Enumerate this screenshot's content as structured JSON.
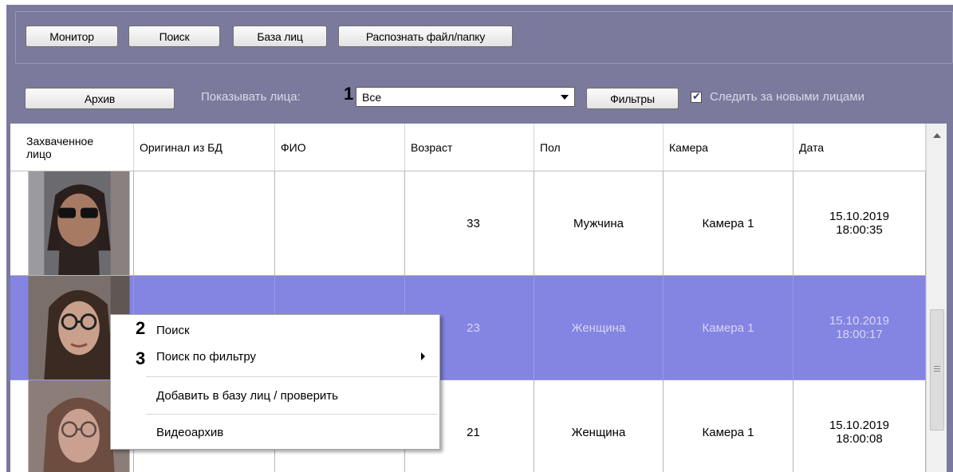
{
  "toolbar_top": {
    "buttons": [
      "Монитор",
      "Поиск",
      "База лиц",
      "Распознать файл/папку"
    ]
  },
  "toolbar_mid": {
    "archive_label": "Архив",
    "show_faces_label": "Показывать лица:",
    "show_faces_value": "Все",
    "filters_label": "Фильтры",
    "follow_new_label": "Следить за новыми лицами",
    "follow_new_checked": true
  },
  "callouts": [
    "1",
    "2",
    "3"
  ],
  "table": {
    "headers": [
      "Захваченное лицо",
      "Оригинал из БД",
      "ФИО",
      "Возраст",
      "Пол",
      "Камера",
      "Дата"
    ],
    "rows": [
      {
        "age": "33",
        "gender": "Мужчина",
        "camera": "Камера 1",
        "date": "15.10.2019",
        "time": "18:00:35",
        "selected": false
      },
      {
        "age": "23",
        "gender": "Женщина",
        "camera": "Камера 1",
        "date": "15.10.2019",
        "time": "18:00:17",
        "selected": true
      },
      {
        "age": "21",
        "gender": "Женщина",
        "camera": "Камера 1",
        "date": "15.10.2019",
        "time": "18:00:08",
        "selected": false
      }
    ]
  },
  "context_menu": {
    "items": [
      "Поиск",
      "Поиск по фильтру",
      "Добавить в базу лиц / проверить",
      "Видеоархив"
    ]
  },
  "colors": {
    "frame": "#7b7a9d",
    "selection": "#8484e2",
    "label_on_frame": "#d9d9e6"
  }
}
